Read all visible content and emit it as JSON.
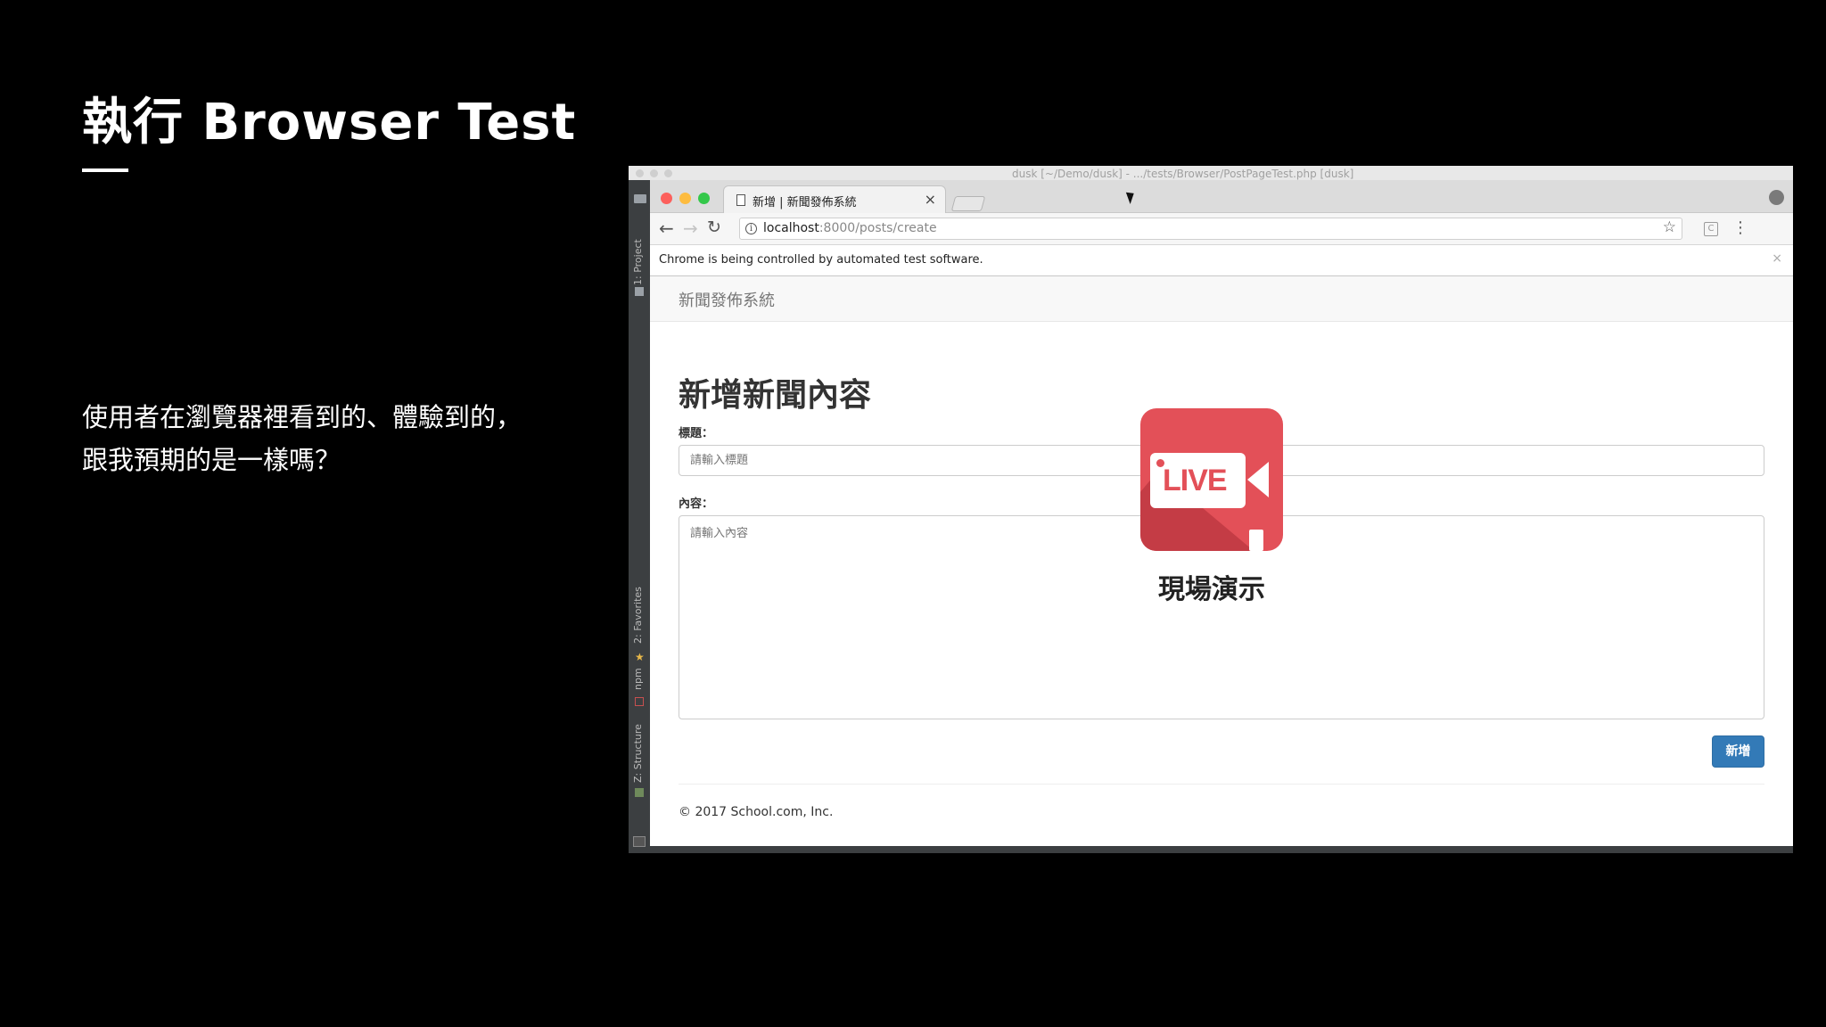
{
  "slide": {
    "title": "執行 Browser Test",
    "body_line1": "使用者在瀏覽器裡看到的、體驗到的，",
    "body_line2": "跟我預期的是一樣嗎？"
  },
  "ide": {
    "title": "dusk [~/Demo/dusk] - .../tests/Browser/PostPageTest.php [dusk]",
    "side_tabs": [
      "1: Project",
      "2: Favorites",
      "npm",
      "Z: Structure"
    ]
  },
  "browser": {
    "tab_title": "新增 | 新聞發佈系統",
    "tab_close": "×",
    "url_host": "localhost",
    "url_path": ":8000/posts/create",
    "infobar_text": "Chrome is being controlled by automated test software.",
    "infobar_close": "×",
    "icons": {
      "back": "back-arrow-icon",
      "forward": "forward-arrow-icon",
      "reload": "reload-icon",
      "info": "info-icon",
      "bookmark": "star-icon",
      "extension": "extension-icon",
      "menu": "menu-dots-icon",
      "profile": "profile-icon"
    }
  },
  "page": {
    "brand": "新聞發佈系統",
    "heading": "新增新聞內容",
    "title_label": "標題：",
    "title_placeholder": "請輸入標題",
    "content_label": "內容：",
    "content_placeholder": "請輸入內容",
    "submit_label": "新增",
    "footer": "© 2017 School.com, Inc."
  },
  "overlay": {
    "badge_text": "LIVE",
    "caption": "現場演示",
    "colors": {
      "badge": "#e35058",
      "badge_shadow": "#c43c45"
    }
  },
  "colors": {
    "slide_bg": "#000000",
    "primary_button": "#337ab7"
  }
}
